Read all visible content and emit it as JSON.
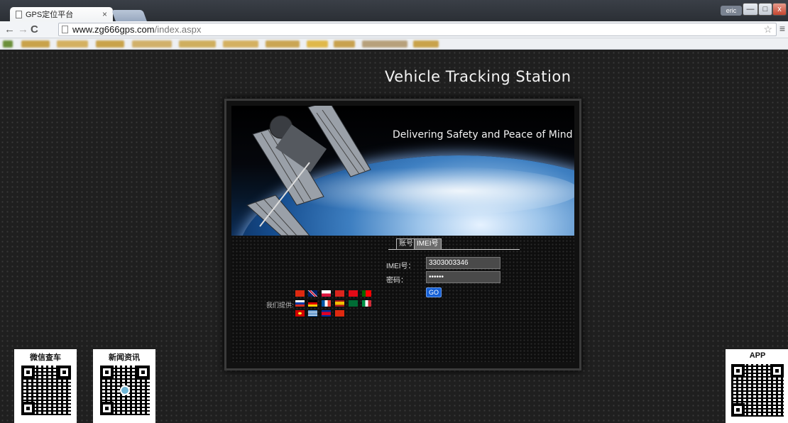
{
  "browser": {
    "tab_title": "GPS定位平台",
    "tab_close": "×",
    "user_badge": "eric",
    "url_host": "www.zg666gps.com",
    "url_path": "/index.aspx",
    "win_min": "—",
    "win_max": "□",
    "win_close": "x"
  },
  "header": {
    "site_title": "Vehicle Tracking Station",
    "tagline": "Delivering Safety and Peace of Mind"
  },
  "login": {
    "tab_account": "账号",
    "tab_imei": "IMEI号",
    "imei_label": "IMEI号：",
    "imei_value": "3303003346",
    "password_label": "密码：",
    "password_value": "123456",
    "go_label": "GO"
  },
  "languages": {
    "label": "我们提供:",
    "flags": [
      "china",
      "uk",
      "poland",
      "vietnam",
      "turkey",
      "portugal",
      "russia",
      "germany",
      "france",
      "spain",
      "saudi-arabia",
      "italy",
      "macedonia",
      "greece",
      "cambodia",
      "hong-kong"
    ]
  },
  "qr": {
    "wechat_title": "微信查车",
    "news_title": "新闻资讯",
    "app_title": "APP"
  },
  "colors": {
    "go_button": "#1560d6",
    "page_background": "#1f1f1f"
  }
}
